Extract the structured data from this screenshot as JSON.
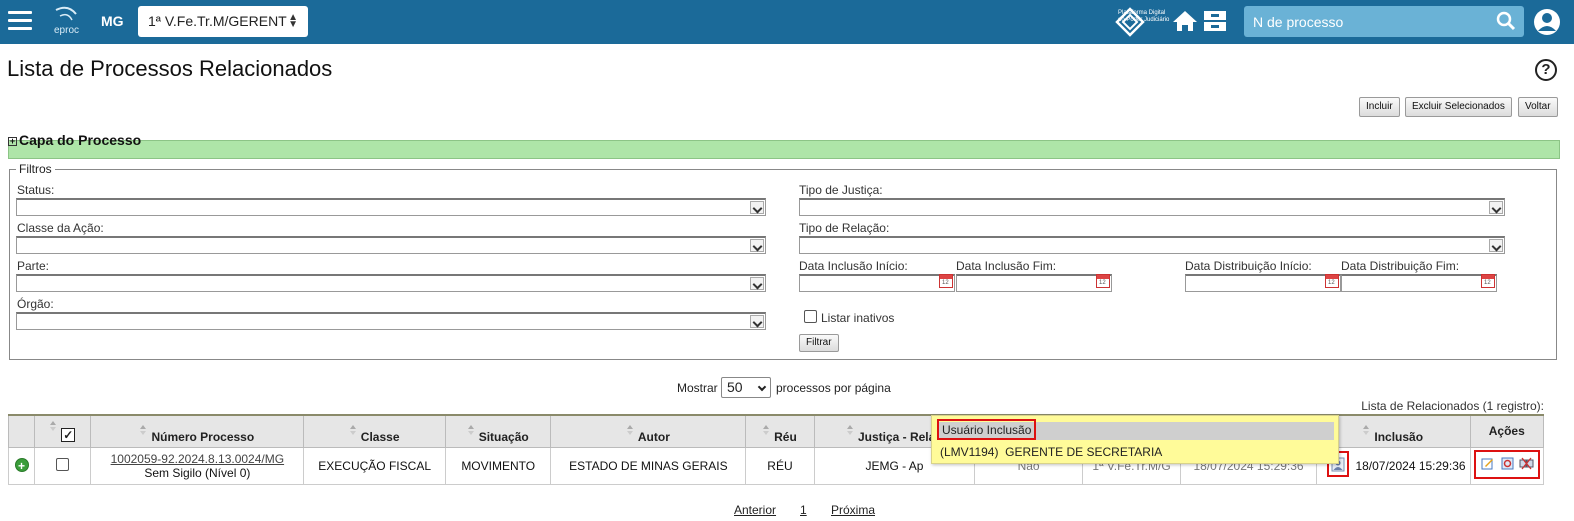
{
  "topbar": {
    "logo_text": "eproc",
    "uf": "MG",
    "org_select_value": "1ª V.Fe.Tr.M/GERENT",
    "pdpj_text": "Plataforma Digital do Poder Judiciário",
    "search_placeholder": "N de processo",
    "bg_color": "#1b6a99"
  },
  "page": {
    "title": "Lista de Processos Relacionados",
    "buttons": {
      "incluir": "Incluir",
      "excluir": "Excluir Selecionados",
      "voltar": "Voltar"
    }
  },
  "capa": {
    "title": "Capa do Processo"
  },
  "filtros": {
    "legend": "Filtros",
    "status_label": "Status:",
    "classe_label": "Classe da Ação:",
    "parte_label": "Parte:",
    "orgao_label": "Órgão:",
    "tipo_justica_label": "Tipo de Justiça:",
    "tipo_relacao_label": "Tipo de Relação:",
    "data_inclusao_inicio_label": "Data Inclusão Início:",
    "data_inclusao_fim_label": "Data Inclusão Fim:",
    "data_distribuicao_inicio_label": "Data Distribuição Início:",
    "data_distribuicao_fim_label": "Data Distribuição Fim:",
    "listar_inativos_label": "Listar inativos",
    "filtrar_button": "Filtrar"
  },
  "paging": {
    "mostrar": "Mostrar",
    "per_page": "50",
    "suffix": "processos por página"
  },
  "table": {
    "caption": "Lista de Relacionados (1 registro):",
    "headers": {
      "numero": "Número Processo",
      "classe": "Classe",
      "situacao": "Situação",
      "autor": "Autor",
      "reu": "Réu",
      "justica": "Justiça - Relaç",
      "inclusao": "Inclusão",
      "acoes": "Ações"
    },
    "row": {
      "numero": "1002059-92.2024.8.13.0024/MG",
      "sigilo": "Sem Sigilo (Nível 0)",
      "classe": "EXECUÇÃO FISCAL",
      "situacao": "MOVIMENTO",
      "autor": "ESTADO DE MINAS GERAIS",
      "reu": "RÉU",
      "justica": "JEMG - Ap",
      "col_hidden_1": "Não",
      "col_hidden_2": "1ª V.Fe.Tr.M/G",
      "col_hidden_3": "18/07/2024 15:29:36",
      "inclusao": "18/07/2024 15:29:36"
    }
  },
  "tooltip": {
    "header": "Usuário Inclusão",
    "code": "(LMV1194)",
    "role": "GERENTE DE SECRETARIA"
  },
  "pager": {
    "anterior": "Anterior",
    "page": "1",
    "proxima": "Próxima"
  }
}
